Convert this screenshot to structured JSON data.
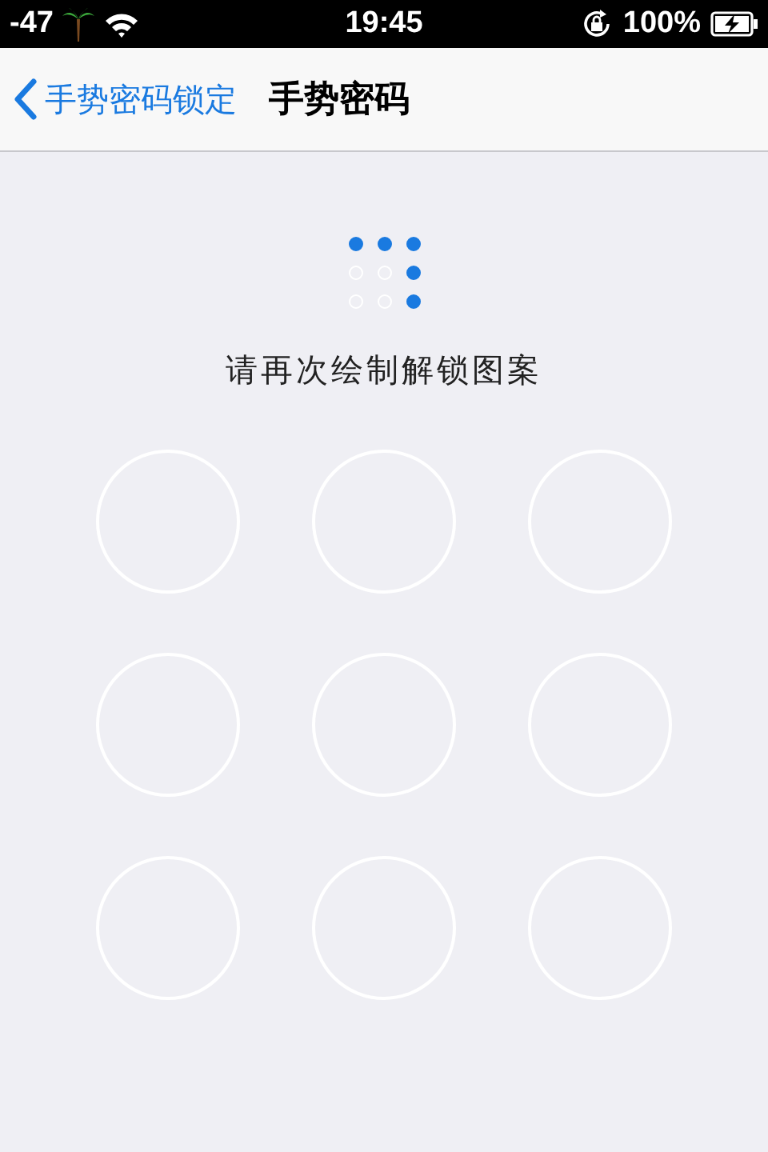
{
  "status_bar": {
    "signal": "-47",
    "time": "19:45",
    "battery": "100%"
  },
  "nav": {
    "back": "手势密码锁定",
    "title": "手势密码"
  },
  "preview": [
    {
      "on": true
    },
    {
      "on": true
    },
    {
      "on": true
    },
    {
      "on": false
    },
    {
      "on": false
    },
    {
      "on": true
    },
    {
      "on": false
    },
    {
      "on": false
    },
    {
      "on": true
    }
  ],
  "prompt": "请再次绘制解锁图案",
  "pad": [
    {
      "selected": false
    },
    {
      "selected": false
    },
    {
      "selected": false
    },
    {
      "selected": false
    },
    {
      "selected": false
    },
    {
      "selected": false
    },
    {
      "selected": false
    },
    {
      "selected": false
    },
    {
      "selected": false
    }
  ]
}
